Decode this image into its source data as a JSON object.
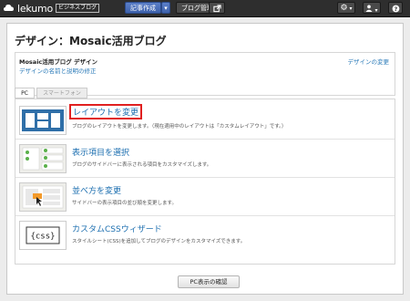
{
  "topbar": {
    "logo_text": "lekumo",
    "logo_badge": "ビジネスブログ",
    "compose_label": "記事作成",
    "blog_manage_label": "ブログ管理",
    "icons": [
      "external-link-icon",
      "gear-icon",
      "user-icon",
      "help-icon"
    ]
  },
  "page": {
    "title": "デザイン：Mosaic活用ブログ"
  },
  "info": {
    "design_name": "Mosaic活用ブログ デザイン",
    "edit_link": "デザインの名前と説明の修正",
    "change_link": "デザインの変更"
  },
  "tabs": [
    {
      "label": "PC",
      "active": true
    },
    {
      "label": "スマートフォン",
      "active": false
    }
  ],
  "items": [
    {
      "title": "レイアウトを変更",
      "desc": "ブログのレイアウトを変更します。（現在適用中のレイアウトは「カスタムレイアウト」です。）",
      "icon": "layout-icon"
    },
    {
      "title": "表示項目を選択",
      "desc": "ブログのサイドバーに表示される項目をカスタマイズします。",
      "icon": "display-items-icon"
    },
    {
      "title": "並べ方を変更",
      "desc": "サイドバーの表示項目の並び順を変更します。",
      "icon": "reorder-icon"
    },
    {
      "title": "カスタムCSSウィザード",
      "desc": "スタイルシート(CSS)を追加してブログのデザインをカスタマイズできます。",
      "icon": "css-icon"
    }
  ],
  "footer": {
    "confirm_label": "PC表示の確認"
  },
  "colors": {
    "link": "#1d6fb0",
    "highlight": "#e02020",
    "topbar": "#2e2e2e",
    "accent_blue": "#3e62ac"
  }
}
